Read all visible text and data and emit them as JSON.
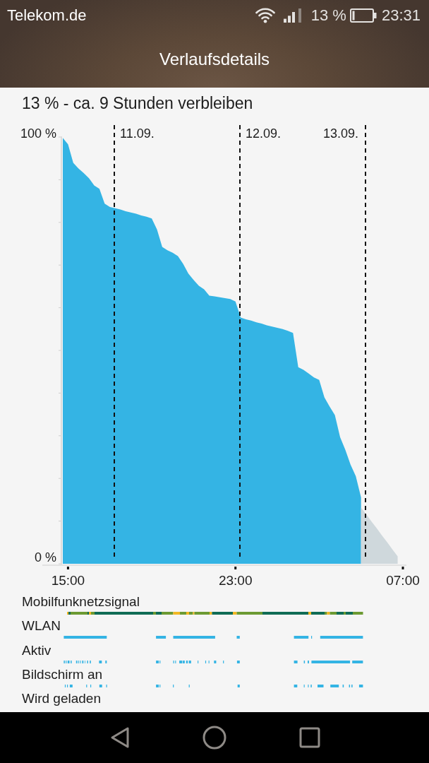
{
  "status_bar": {
    "carrier": "Telekom.de",
    "battery": "13 %",
    "time": "23:31"
  },
  "title": "Verlaufsdetails",
  "summary": "13 % - ca. 9 Stunden verbleiben",
  "battery_chart": {
    "chart_data": {
      "type": "area",
      "categories": [
        null,
        "15:00",
        null,
        null,
        null,
        null,
        null,
        null,
        null,
        null,
        null,
        null,
        null,
        null,
        null,
        null,
        null,
        null,
        null,
        null,
        null,
        null,
        null,
        null,
        null,
        null,
        null,
        null,
        null,
        null,
        null,
        null,
        null,
        "23:00",
        null,
        null,
        null,
        null,
        null,
        null,
        null,
        null,
        null,
        null,
        null,
        null,
        null,
        null,
        null,
        null,
        null,
        null,
        null,
        null,
        null,
        null,
        null,
        null,
        null,
        null,
        null,
        null,
        null,
        null,
        null,
        "07:00"
      ],
      "series": [
        {
          "color": "#34b4e4",
          "values": [
            98.8,
            97.3,
            92.9,
            91.6,
            90.5,
            89.3,
            87.6,
            86.8,
            83.3,
            82.5,
            82.2,
            81.9,
            81.5,
            81.2,
            80.9,
            80.5,
            80.2,
            79.8,
            77.2,
            73.1,
            72.3,
            71.7,
            70.9,
            69.1,
            66.8,
            65.3,
            63.9,
            63.1,
            61.6,
            61.4,
            61.2,
            61.0,
            60.8,
            60.2,
            56.4,
            56.0,
            55.7,
            55.3,
            55.0,
            54.6,
            54.3,
            54.0,
            53.7,
            53.3,
            52.8,
            44.7,
            44.1,
            43.2,
            42.3,
            41.7,
            37.6,
            35.4,
            33.4,
            28.2,
            25.2,
            21.7,
            19.0,
            14.0,
            null,
            null,
            null,
            null,
            null,
            null,
            null,
            null
          ]
        },
        {
          "color": "#cfd8dc",
          "values": [
            null,
            null,
            null,
            null,
            null,
            null,
            null,
            null,
            null,
            null,
            null,
            null,
            null,
            null,
            null,
            null,
            null,
            null,
            null,
            null,
            null,
            null,
            null,
            null,
            null,
            null,
            null,
            null,
            null,
            null,
            null,
            null,
            null,
            null,
            null,
            null,
            null,
            null,
            null,
            null,
            null,
            null,
            null,
            null,
            null,
            null,
            null,
            null,
            null,
            null,
            null,
            null,
            null,
            null,
            null,
            null,
            null,
            11.6,
            10.0,
            8.3,
            6.7,
            5.0,
            3.4,
            1.7,
            0.1,
            null
          ]
        }
      ],
      "ylim": [
        0,
        100
      ],
      "yticks": [
        {
          "value": 0,
          "label": "0 %"
        },
        {
          "value": 100,
          "label": "100 %"
        }
      ],
      "annotations": [
        "11.09.",
        "12.09.",
        "13.09."
      ]
    }
  },
  "usage_tracks": [
    {
      "label": "Mobilfunknetzsignal",
      "kind": "signal"
    },
    {
      "label": "WLAN",
      "kind": "blocks"
    },
    {
      "label": "Aktiv",
      "kind": "blocks"
    },
    {
      "label": "Bildschirm an",
      "kind": "blocks"
    },
    {
      "label": "Wird geladen",
      "kind": "blocks"
    }
  ]
}
